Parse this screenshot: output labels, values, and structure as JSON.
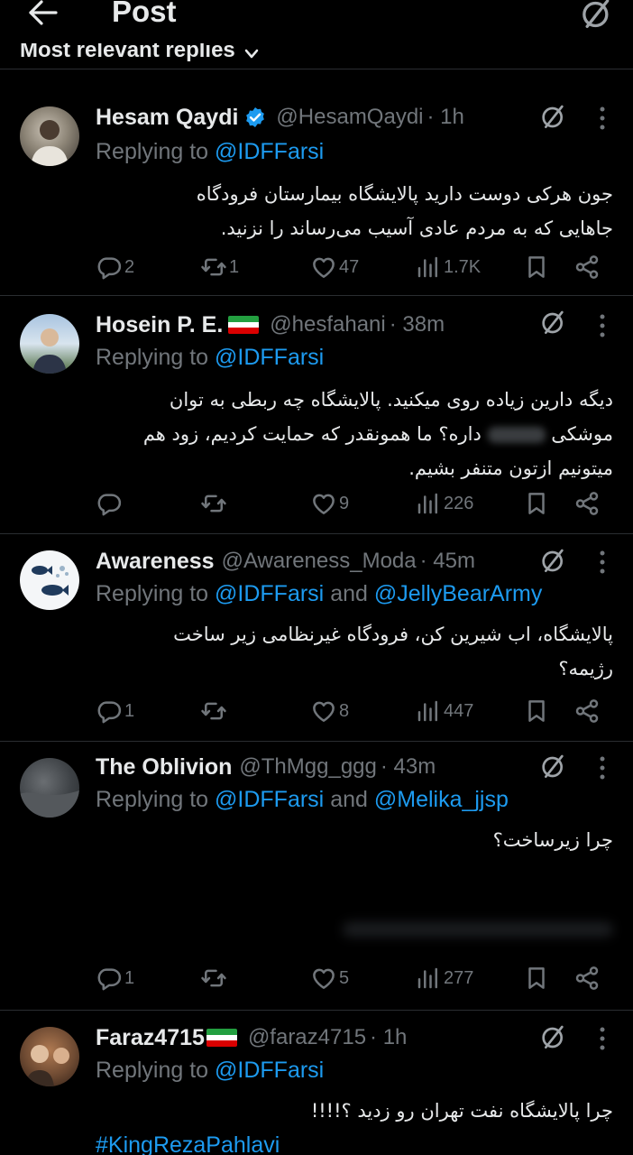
{
  "header": {
    "title": "Post",
    "back_icon": "arrow-left-icon",
    "grok_icon": "grok-icon"
  },
  "sort": {
    "label": "Most relevant replies"
  },
  "replies": [
    {
      "name": "Hesam Qaydi",
      "verified": true,
      "handle": "@HesamQaydi",
      "time": "· 1h",
      "replying_prefix": "Replying to ",
      "replying_to": "@IDFFarsi",
      "text_lines": [
        "جون هرکی دوست دارید پالایشگاه بیمارستان فرودگاه",
        "جاهایی که به مردم عادی آسیب می‌رساند را نزنید."
      ],
      "counts": {
        "replies": "2",
        "reposts": "1",
        "likes": "47",
        "views": "1.7K"
      }
    },
    {
      "name": "Hosein P. E.",
      "flag": true,
      "handle": "@hesfahani",
      "time": "· 38m",
      "replying_prefix": "Replying to ",
      "replying_to": "@IDFFarsi",
      "text_lines": [
        "دیگه دارین زیاده روی میکنید. پالایشگاه چه ربطی به توان",
        "موشکی",
        "داره؟ ما همونقدر که حمایت کردیم، زود هم",
        "میتونیم ازتون متنفر بشیم."
      ],
      "counts": {
        "replies": "",
        "reposts": "",
        "likes": "9",
        "views": "226"
      }
    },
    {
      "name": "Awareness",
      "handle": "@Awareness_Moda",
      "time": "· 45m",
      "replying_prefix": "Replying to ",
      "replying_to": "@IDFFarsi",
      "replying_and": " and ",
      "replying_to2": "@JellyBearArmy",
      "text_lines": [
        "پالایشگاه، اب شیرین کن، فرودگاه غیرنظامی زیر ساخت",
        "رژیمه؟"
      ],
      "counts": {
        "replies": "1",
        "reposts": "",
        "likes": "8",
        "views": "447"
      }
    },
    {
      "name": "The Oblivion",
      "handle": "@ThMgg_ggg",
      "time": "· 43m",
      "replying_prefix": "Replying to ",
      "replying_to": "@IDFFarsi",
      "replying_and": " and ",
      "replying_to2": "@Melika_jjsp",
      "text_lines": [
        "چرا زیرساخت؟"
      ],
      "counts": {
        "replies": "1",
        "reposts": "",
        "likes": "5",
        "views": "277"
      }
    },
    {
      "name": "Faraz4715",
      "flag": true,
      "handle": "@faraz4715",
      "time": "· 1h",
      "replying_prefix": "Replying to ",
      "replying_to": "@IDFFarsi",
      "text_lines": [
        "چرا پالایشگاه نفت تهران رو زدید ؟!!!!"
      ],
      "hashtag": "#KingRezaPahlavi"
    }
  ],
  "colors": {
    "background": "#000000",
    "text": "#e7e9ea",
    "secondary": "#71767b",
    "accent": "#1d9bf0",
    "verified": "#1d9bf0"
  }
}
